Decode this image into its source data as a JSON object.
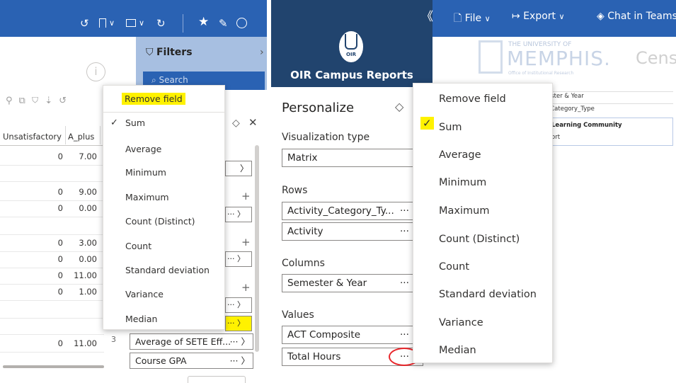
{
  "left": {
    "headers": [
      "Unsatisfactory",
      "A_plus"
    ],
    "rows": [
      [
        "0",
        "7.00"
      ],
      [
        "",
        ""
      ],
      [
        "0",
        "9.00"
      ],
      [
        "0",
        "0.00"
      ],
      [
        "",
        ""
      ],
      [
        "0",
        "3.00"
      ],
      [
        "0",
        "0.00"
      ],
      [
        "0",
        "11.00"
      ],
      [
        "0",
        "1.00"
      ],
      [
        "",
        ""
      ],
      [
        "",
        ""
      ],
      [
        "0",
        "11.00"
      ]
    ],
    "filters_title": "Filters",
    "search_placeholder": "Search",
    "info_glyph": "i",
    "menu": {
      "remove_label": "Remove field",
      "check": "✓",
      "items": [
        "Sum",
        "Average",
        "Minimum",
        "Maximum",
        "Count (Distinct)",
        "Count",
        "Standard deviation",
        "Variance",
        "Median"
      ]
    },
    "fields": [
      {
        "label": "Average of SETE Eff...",
        "more": "···"
      },
      {
        "label": "Course GPA",
        "more": "···"
      }
    ],
    "more_glyph": "···",
    "plus_glyph": "+",
    "chev": "〉",
    "close_glyph": "✕",
    "clip_glyph": "3"
  },
  "right": {
    "collapse_glyph": "《",
    "file_label": "File",
    "export_label": "Export",
    "chat_label": "Chat in Teams",
    "report_title": "OIR Campus Reports",
    "logo_text": "OIR",
    "um_name_line1": "THE UNIVERSITY OF",
    "um_name_line2": "MEMPHIS.",
    "um_dept": "Office of Institutional Research",
    "cens_label": "Cens",
    "personalize_title": "Personalize",
    "viz_label": "Visualization type",
    "viz_value": "Matrix",
    "rows_label": "Rows",
    "rows_fields": [
      "Activity_Category_Ty...",
      "Activity"
    ],
    "columns_label": "Columns",
    "columns_fields": [
      "Semester & Year"
    ],
    "values_label": "Values",
    "values_fields": [
      "ACT Composite",
      "Total Hours"
    ],
    "more_glyph": "···",
    "bg_rows": [
      "ester & Year",
      "_Category_Type",
      "s Learning Community",
      "ort"
    ],
    "menu": {
      "check": "✓",
      "items": [
        "Remove field",
        "Sum",
        "Average",
        "Minimum",
        "Maximum",
        "Count (Distinct)",
        "Count",
        "Standard deviation",
        "Variance",
        "Median"
      ]
    }
  },
  "colors": {
    "titlebar": "#2a62b3",
    "report_blue": "#21446e",
    "highlight": "#fff200",
    "annotation_red": "#e8262b"
  }
}
